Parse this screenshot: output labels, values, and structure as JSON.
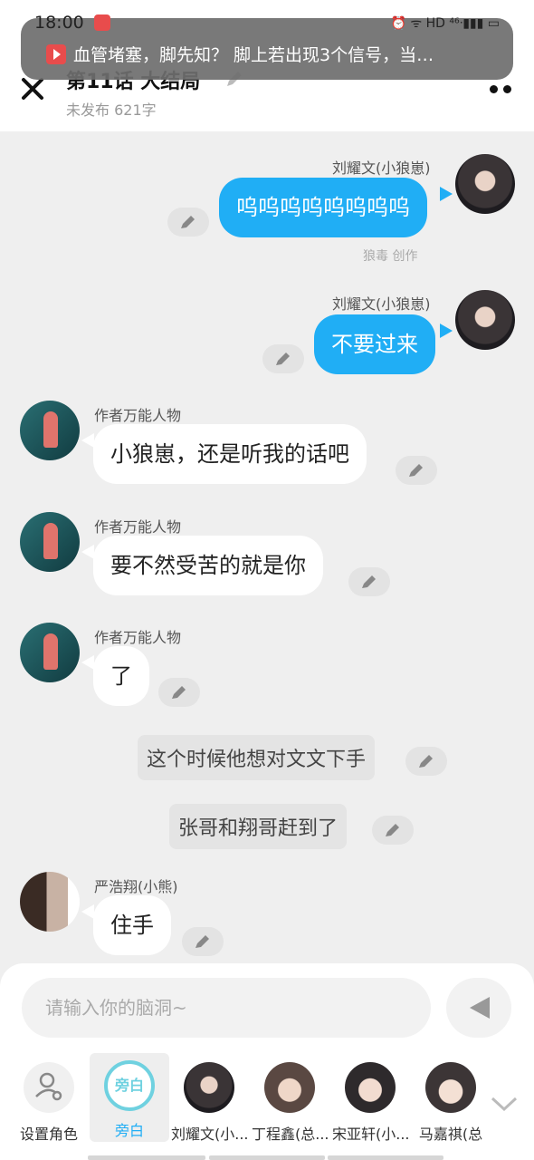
{
  "status_bar": {
    "time": "18:00",
    "icons": "⏰ ᯤ HD ⁴⁶ᐧ▮▮▮ ▭"
  },
  "notification": {
    "text": "血管堵塞，脚先知？ 脚上若出现3个信号，当…"
  },
  "header": {
    "title": "第11话  大结局",
    "subtitle": "未发布 621字"
  },
  "messages": [
    {
      "speaker": "刘耀文(小狼崽)",
      "text": "呜呜呜呜呜呜呜呜",
      "side": "right"
    },
    {
      "speaker": "刘耀文(小狼崽)",
      "text": "不要过来",
      "side": "right"
    },
    {
      "speaker": "作者万能人物",
      "text": "小狼崽，还是听我的话吧",
      "side": "left"
    },
    {
      "speaker": "作者万能人物",
      "text": "要不然受苦的就是你",
      "side": "left"
    },
    {
      "speaker": "作者万能人物",
      "text": "了",
      "side": "left"
    },
    {
      "speaker": "",
      "text": "这个时候他想对文文下手",
      "side": "narration"
    },
    {
      "speaker": "",
      "text": "张哥和翔哥赶到了",
      "side": "narration"
    },
    {
      "speaker": "严浩翔(小熊)",
      "text": "住手",
      "side": "left"
    }
  ],
  "credit": "狼毒 创作",
  "input": {
    "placeholder": "请输入你的脑洞~"
  },
  "roles": [
    {
      "label": "设置角色"
    },
    {
      "label": "旁白",
      "badge": "旁白"
    },
    {
      "label": "刘耀文(小..."
    },
    {
      "label": "丁程鑫(总..."
    },
    {
      "label": "宋亚轩(小..."
    },
    {
      "label": "马嘉祺(总"
    }
  ],
  "colors": {
    "accent": "#20aef5",
    "narration_ring": "#6fd1e0"
  }
}
